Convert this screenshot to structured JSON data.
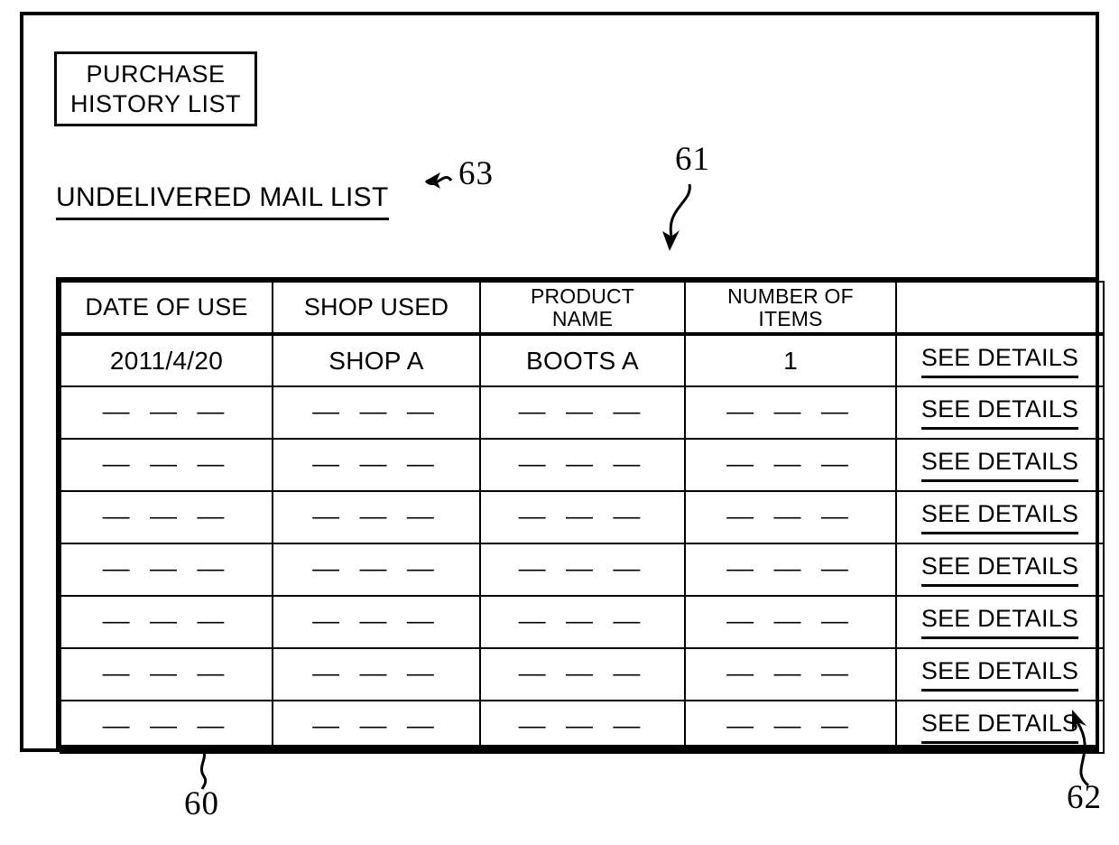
{
  "figure": {
    "screen_title_lines": [
      "PURCHASE",
      "HISTORY LIST"
    ],
    "undelivered_link_label": "UNDELIVERED MAIL LIST",
    "reference_numerals": {
      "device": "60",
      "table": "61",
      "see_details_link": "62",
      "undelivered_mail_link": "63"
    }
  },
  "table": {
    "headers": [
      {
        "line1": "DATE OF USE",
        "line2": ""
      },
      {
        "line1": "SHOP USED",
        "line2": ""
      },
      {
        "line1": "PRODUCT",
        "line2": "NAME"
      },
      {
        "line1": "NUMBER OF",
        "line2": "ITEMS"
      },
      {
        "line1": "",
        "line2": ""
      }
    ],
    "link_label": "SEE DETAILS",
    "placeholder": "— — —",
    "rows": [
      {
        "date_of_use": "2011/4/20",
        "shop_used": "SHOP A",
        "product_name": "BOOTS A",
        "number_of_items": "1",
        "link": "SEE DETAILS"
      },
      {
        "date_of_use": "— — —",
        "shop_used": "— — —",
        "product_name": "— — —",
        "number_of_items": "— — —",
        "link": "SEE DETAILS"
      },
      {
        "date_of_use": "— — —",
        "shop_used": "— — —",
        "product_name": "— — —",
        "number_of_items": "— — —",
        "link": "SEE DETAILS"
      },
      {
        "date_of_use": "— — —",
        "shop_used": "— — —",
        "product_name": "— — —",
        "number_of_items": "— — —",
        "link": "SEE DETAILS"
      },
      {
        "date_of_use": "— — —",
        "shop_used": "— — —",
        "product_name": "— — —",
        "number_of_items": "— — —",
        "link": "SEE DETAILS"
      },
      {
        "date_of_use": "— — —",
        "shop_used": "— — —",
        "product_name": "— — —",
        "number_of_items": "— — —",
        "link": "SEE DETAILS"
      },
      {
        "date_of_use": "— — —",
        "shop_used": "— — —",
        "product_name": "— — —",
        "number_of_items": "— — —",
        "link": "SEE DETAILS"
      },
      {
        "date_of_use": "— — —",
        "shop_used": "— — —",
        "product_name": "— — —",
        "number_of_items": "— — —",
        "link": "SEE DETAILS"
      }
    ]
  },
  "colors": {
    "ink": "#000000",
    "paper": "#ffffff"
  }
}
